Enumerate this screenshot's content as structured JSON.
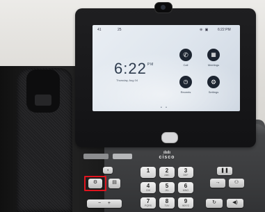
{
  "screen": {
    "status_ext": "41",
    "status_line": "25",
    "status_time": "6:22 PM",
    "clock": "6:22",
    "ampm": "PM",
    "date": "Thursday, Aug 04",
    "apps": [
      {
        "label": "Call",
        "icon": "phone-icon"
      },
      {
        "label": "Meetings",
        "icon": "calendar-icon"
      },
      {
        "label": "Recents",
        "icon": "clock-icon"
      },
      {
        "label": "Settings",
        "icon": "gear-icon"
      }
    ],
    "page_dots": "• •"
  },
  "brand": {
    "name": "cisco"
  },
  "keypad": {
    "keys": [
      {
        "d": "1",
        "l": ""
      },
      {
        "d": "2",
        "l": "ABC"
      },
      {
        "d": "3",
        "l": "DEF"
      },
      {
        "d": "4",
        "l": "GHI"
      },
      {
        "d": "5",
        "l": "JKL"
      },
      {
        "d": "6",
        "l": "MNO"
      },
      {
        "d": "7",
        "l": "PQRS"
      },
      {
        "d": "8",
        "l": "TUV"
      },
      {
        "d": "9",
        "l": "WXYZ"
      }
    ]
  },
  "colors": {
    "highlight": "#e0141e",
    "screen_bg": "#dfe6ee",
    "keys": "#e6e6e6",
    "body": "#3a3b3d"
  }
}
